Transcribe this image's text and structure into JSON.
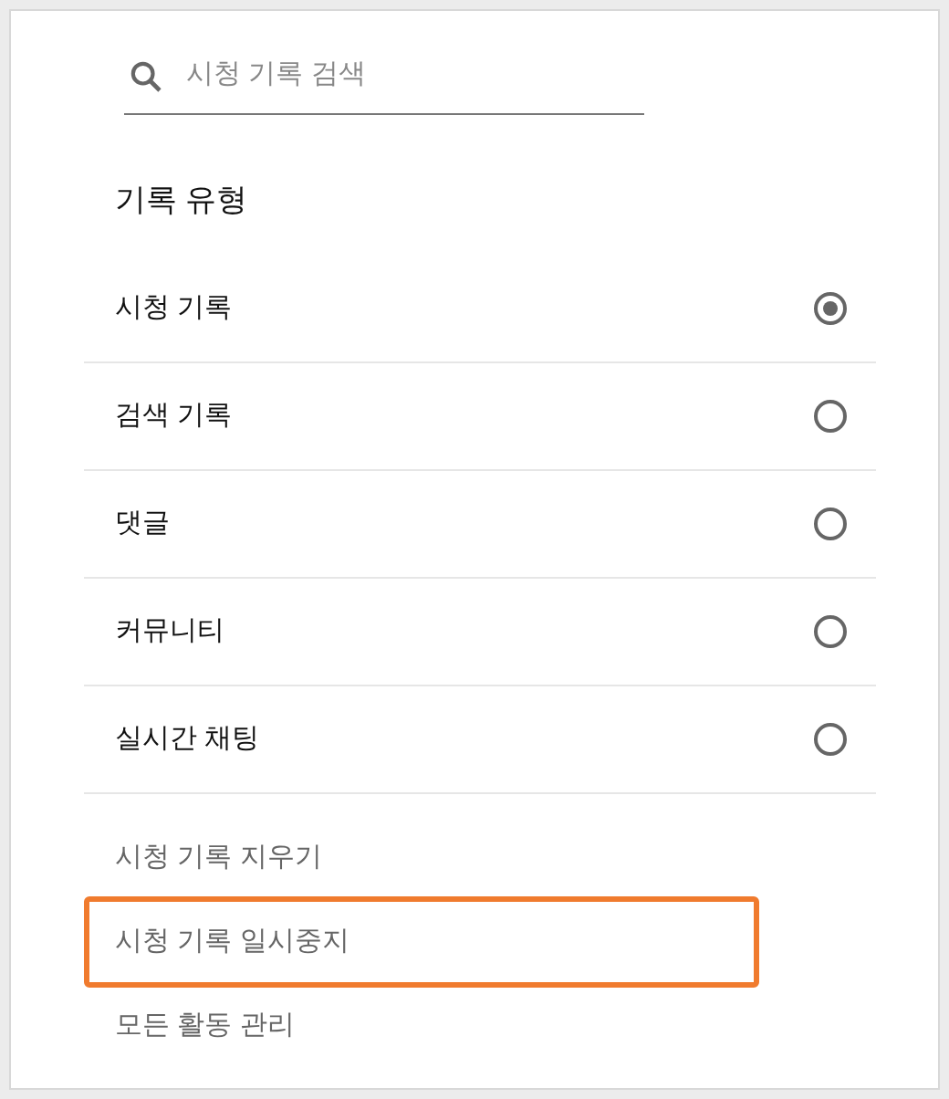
{
  "search": {
    "placeholder": "시청 기록 검색"
  },
  "section": {
    "title": "기록 유형"
  },
  "history_types": [
    {
      "label": "시청 기록",
      "selected": true
    },
    {
      "label": "검색 기록",
      "selected": false
    },
    {
      "label": "댓글",
      "selected": false
    },
    {
      "label": "커뮤니티",
      "selected": false
    },
    {
      "label": "실시간 채팅",
      "selected": false
    }
  ],
  "actions": [
    {
      "label": "시청 기록 지우기",
      "highlighted": false
    },
    {
      "label": "시청 기록 일시중지",
      "highlighted": true
    },
    {
      "label": "모든 활동 관리",
      "highlighted": false
    }
  ]
}
